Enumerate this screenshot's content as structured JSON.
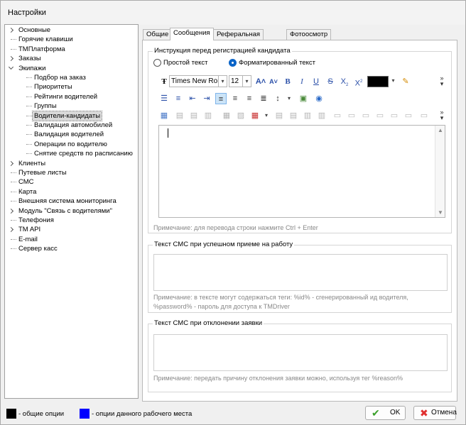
{
  "window": {
    "title": "Настройки"
  },
  "tree": [
    {
      "label": "Основные",
      "level": 0,
      "expander": "collapsed"
    },
    {
      "label": "Горячие клавиши",
      "level": 0,
      "expander": ""
    },
    {
      "label": "ТМПлатформа",
      "level": 0,
      "expander": ""
    },
    {
      "label": "Заказы",
      "level": 0,
      "expander": "collapsed"
    },
    {
      "label": "Экипажи",
      "level": 0,
      "expander": "expanded"
    },
    {
      "label": "Подбор на заказ",
      "level": 1,
      "expander": ""
    },
    {
      "label": "Приоритеты",
      "level": 1,
      "expander": ""
    },
    {
      "label": "Рейтинги водителей",
      "level": 1,
      "expander": ""
    },
    {
      "label": "Группы",
      "level": 1,
      "expander": ""
    },
    {
      "label": "Водители-кандидаты",
      "level": 1,
      "expander": "",
      "selected": true
    },
    {
      "label": "Валидация автомобилей",
      "level": 1,
      "expander": ""
    },
    {
      "label": "Валидация водителей",
      "level": 1,
      "expander": ""
    },
    {
      "label": "Операции по водителю",
      "level": 1,
      "expander": ""
    },
    {
      "label": "Снятие средств по расписанию",
      "level": 1,
      "expander": ""
    },
    {
      "label": "Клиенты",
      "level": 0,
      "expander": "collapsed"
    },
    {
      "label": "Путевые листы",
      "level": 0,
      "expander": ""
    },
    {
      "label": "СМС",
      "level": 0,
      "expander": ""
    },
    {
      "label": "Карта",
      "level": 0,
      "expander": ""
    },
    {
      "label": "Внешняя система мониторинга",
      "level": 0,
      "expander": ""
    },
    {
      "label": "Модуль \"Связь с водителями\"",
      "level": 0,
      "expander": "collapsed"
    },
    {
      "label": "Телефония",
      "level": 0,
      "expander": ""
    },
    {
      "label": "TM API",
      "level": 0,
      "expander": "collapsed"
    },
    {
      "label": "E-mail",
      "level": 0,
      "expander": ""
    },
    {
      "label": "Сервер касс",
      "level": 0,
      "expander": ""
    }
  ],
  "tabs": [
    {
      "label": "Общие"
    },
    {
      "label": "Сообщения",
      "active": true
    },
    {
      "label": "Реферальная система"
    },
    {
      "label": "Фотоосмотр"
    }
  ],
  "instruction_group": {
    "title": "Инструкция перед регистрацией кандидата",
    "radio_plain": "Простой текст",
    "radio_formatted": "Форматированный текст",
    "selected_format": "formatted",
    "font_name": "Times New Roman",
    "font_size": "12",
    "text_color": "#000000",
    "note": "Примечание: для перевода строки нажмите Ctrl + Enter"
  },
  "toolbar_icons": {
    "row1": [
      "font-icon",
      "grow-font-icon",
      "shrink-font-icon",
      "bold-icon",
      "italic-icon",
      "underline-icon",
      "strikethrough-icon",
      "subscript-icon",
      "superscript-icon",
      "text-color-swatch",
      "highlight-icon"
    ],
    "row2": [
      "bullet-list-icon",
      "numbered-list-icon",
      "outdent-icon",
      "indent-icon",
      "align-left-icon",
      "align-center-icon",
      "align-right-icon",
      "justify-icon",
      "line-spacing-icon",
      "insert-image-icon",
      "insert-link-icon"
    ],
    "row3": [
      "insert-table-icon",
      "table-op-icon",
      "table-op-icon",
      "table-op-icon",
      "table-op-icon",
      "table-op-icon",
      "delete-table-icon",
      "table-op-icon",
      "table-op-icon",
      "table-op-icon",
      "table-op-icon",
      "table-op-icon",
      "table-op-icon",
      "table-op-icon",
      "table-op-icon",
      "table-op-icon"
    ]
  },
  "sms_accept_group": {
    "title": "Текст СМС при успешном приеме на работу",
    "value": "",
    "note": "Примечание: в тексте могут содержаться теги: %id% - сгенерированный ид водителя, %password% - пароль для доступа к TMDriver"
  },
  "sms_reject_group": {
    "title": "Текст СМС при отклонении заявки",
    "value": "",
    "note": "Примечание: передать причину отклонения заявки можно, используя тег %reason%"
  },
  "legend": {
    "common_label": "- общие опции",
    "common_color": "#000000",
    "local_label": "- опции данного рабочего места",
    "local_color": "#0000ff"
  },
  "buttons": {
    "ok": "OK",
    "cancel": "Отмена"
  },
  "colors": {
    "ok_check": "#3aa02a",
    "cancel_x": "#e03030",
    "selected_bg": "#d9d9d9",
    "accent": "#0a64c8"
  }
}
